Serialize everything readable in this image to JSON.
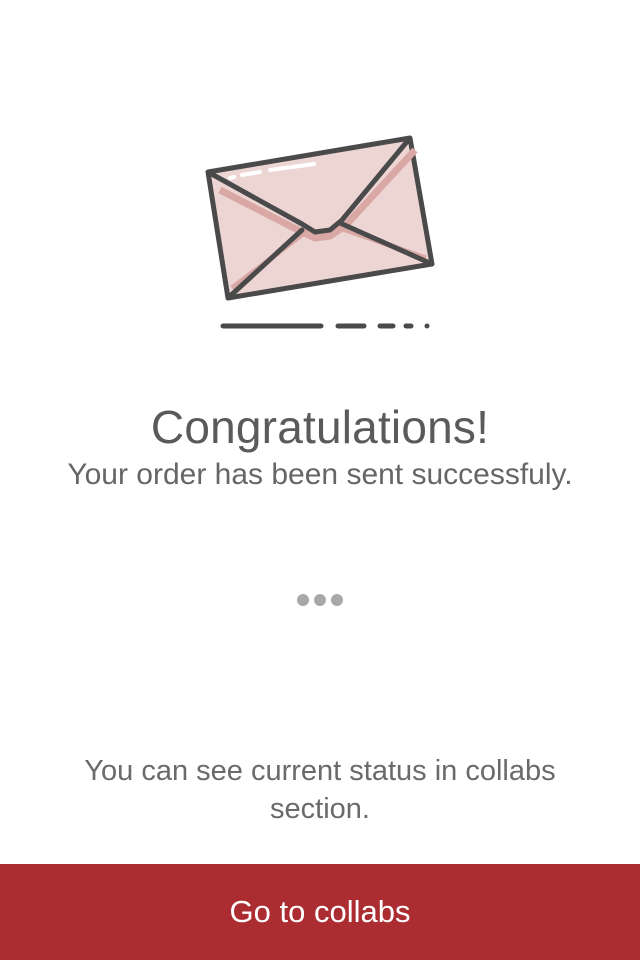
{
  "illustration": {
    "icon": "envelope-icon",
    "colors": {
      "outline": "#4a4a4a",
      "body": "#ecd5d3",
      "shadow": "#d9a8a5"
    }
  },
  "message": {
    "title": "Congratulations!",
    "subtitle": "Your order has been sent successfuly.",
    "info": "You can see current status in collabs section."
  },
  "action": {
    "button_label": "Go to collabs",
    "button_color": "#ac2d31"
  }
}
